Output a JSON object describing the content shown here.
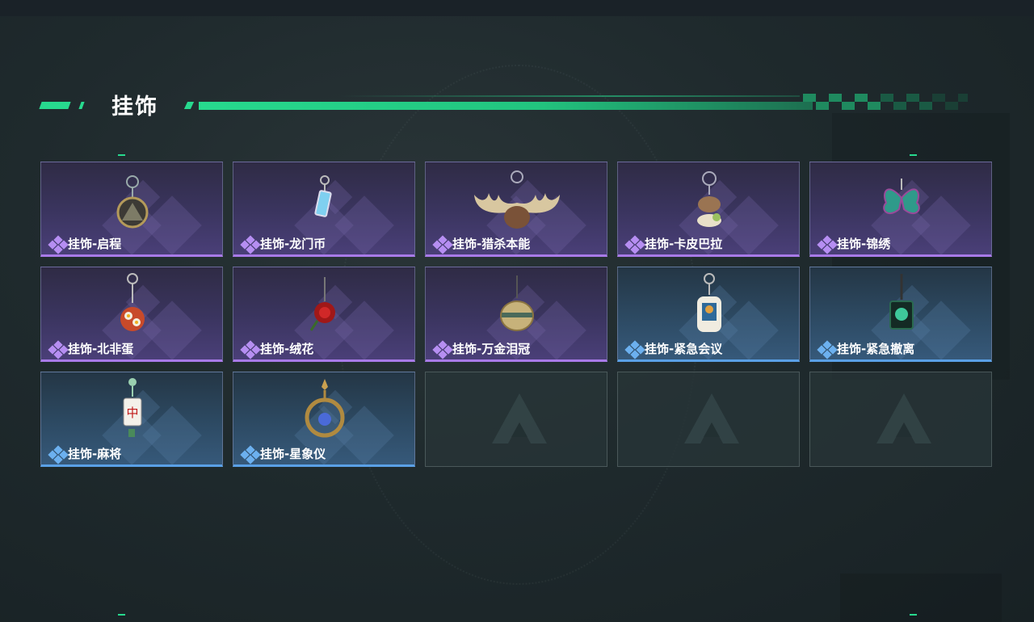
{
  "section": {
    "title": "挂饰"
  },
  "colors": {
    "accent": "#27d98e",
    "purple_rarity": "#a87ae8",
    "blue_rarity": "#5aa0e6"
  },
  "items": [
    {
      "label": "挂饰-启程",
      "rarity": "purple",
      "icon": "pendant-charm-icon"
    },
    {
      "label": "挂饰-龙门币",
      "rarity": "purple",
      "icon": "coin-tag-charm-icon"
    },
    {
      "label": "挂饰-猎杀本能",
      "rarity": "purple",
      "icon": "antlers-charm-icon"
    },
    {
      "label": "挂饰-卡皮巴拉",
      "rarity": "purple",
      "icon": "capybara-charm-icon"
    },
    {
      "label": "挂饰-锦绣",
      "rarity": "purple",
      "icon": "butterfly-charm-icon"
    },
    {
      "label": "挂饰-北非蛋",
      "rarity": "purple",
      "icon": "egg-dish-charm-icon"
    },
    {
      "label": "挂饰-绒花",
      "rarity": "purple",
      "icon": "flower-charm-icon"
    },
    {
      "label": "挂饰-万金泪冠",
      "rarity": "purple",
      "icon": "crown-orb-charm-icon"
    },
    {
      "label": "挂饰-紧急会议",
      "rarity": "blue",
      "icon": "meeting-figure-charm-icon"
    },
    {
      "label": "挂饰-紧急撤离",
      "rarity": "blue",
      "icon": "evacuation-sign-charm-icon"
    },
    {
      "label": "挂饰-麻将",
      "rarity": "blue",
      "icon": "mahjong-tile-charm-icon"
    },
    {
      "label": "挂饰-星象仪",
      "rarity": "blue",
      "icon": "astrolabe-charm-icon"
    },
    {
      "label": "",
      "rarity": "empty",
      "icon": "empty-slot-logo-icon"
    },
    {
      "label": "",
      "rarity": "empty",
      "icon": "empty-slot-logo-icon"
    },
    {
      "label": "",
      "rarity": "empty",
      "icon": "empty-slot-logo-icon"
    }
  ]
}
